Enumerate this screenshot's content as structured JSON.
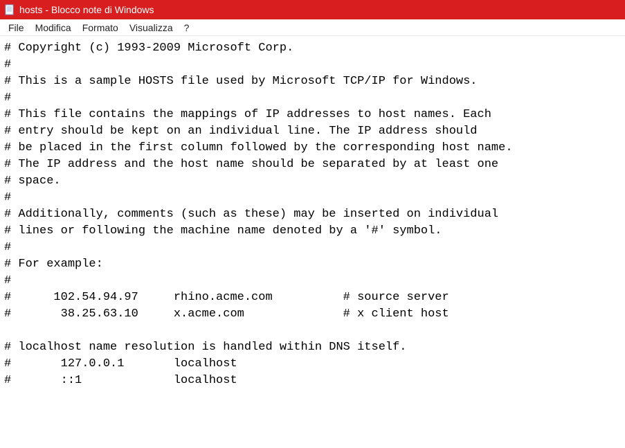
{
  "titlebar": {
    "title": "hosts - Blocco note di Windows"
  },
  "menubar": {
    "items": [
      "File",
      "Modifica",
      "Formato",
      "Visualizza",
      "?"
    ]
  },
  "editor": {
    "content": "# Copyright (c) 1993-2009 Microsoft Corp.\n#\n# This is a sample HOSTS file used by Microsoft TCP/IP for Windows.\n#\n# This file contains the mappings of IP addresses to host names. Each\n# entry should be kept on an individual line. The IP address should\n# be placed in the first column followed by the corresponding host name.\n# The IP address and the host name should be separated by at least one\n# space.\n#\n# Additionally, comments (such as these) may be inserted on individual\n# lines or following the machine name denoted by a '#' symbol.\n#\n# For example:\n#\n#      102.54.94.97     rhino.acme.com          # source server\n#       38.25.63.10     x.acme.com              # x client host\n\n# localhost name resolution is handled within DNS itself.\n#       127.0.0.1       localhost\n#       ::1             localhost"
  }
}
